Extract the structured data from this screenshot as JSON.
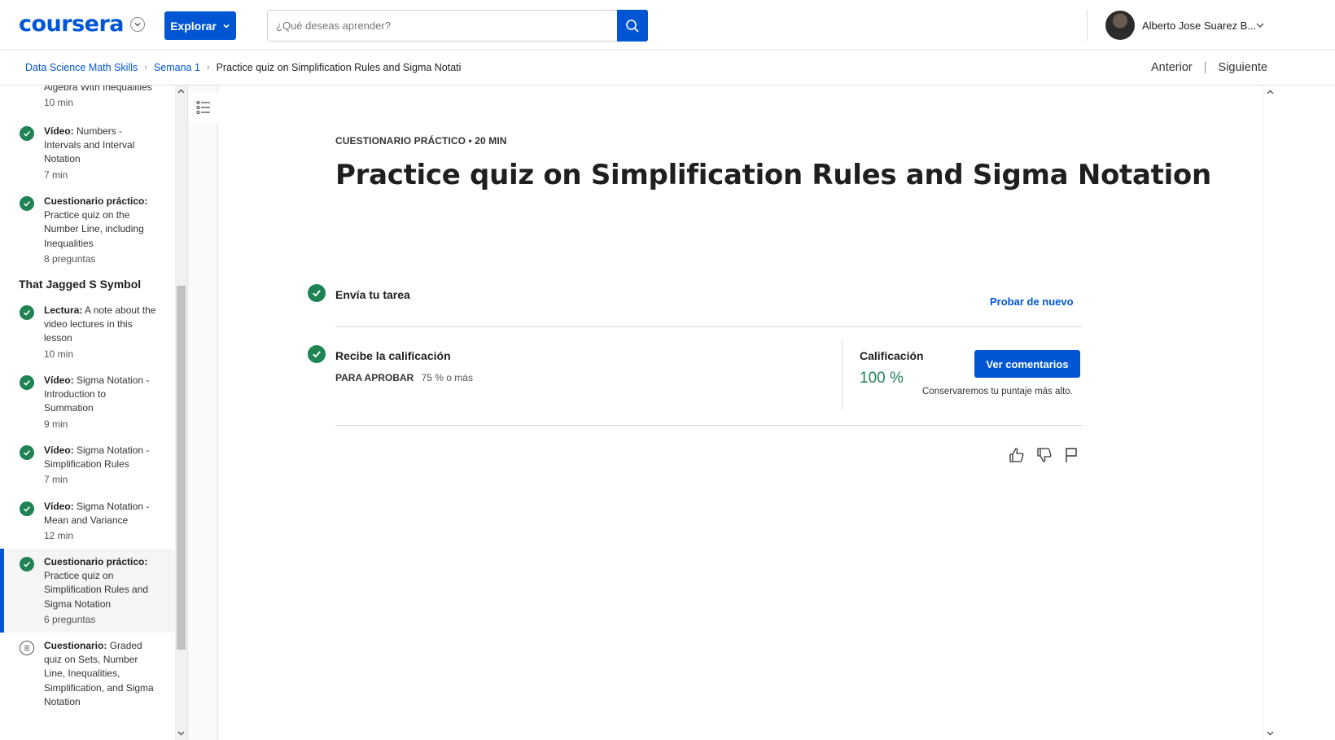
{
  "header": {
    "logo": "coursera",
    "explore_label": "Explorar",
    "search_placeholder": "¿Qué deseas aprender?",
    "user_name": "Alberto Jose Suarez B..."
  },
  "breadcrumb": {
    "course": "Data Science Math Skills",
    "week": "Semana 1",
    "current": "Practice quiz on Simplification Rules and Sigma Notati"
  },
  "nav": {
    "prev": "Anterior",
    "next": "Siguiente"
  },
  "sidebar": {
    "partial_item": {
      "text": "Algebra With Inequalities",
      "meta": "10 min"
    },
    "items_before": [
      {
        "type": "Vídeo:",
        "text": "Numbers - Intervals and Interval Notation",
        "meta": "7 min",
        "status": "complete"
      },
      {
        "type": "Cuestionario práctico:",
        "text": "Practice quiz on the Number Line, including Inequalities",
        "meta": "8 preguntas",
        "status": "complete"
      }
    ],
    "section_title": "That Jagged S Symbol",
    "items": [
      {
        "type": "Lectura:",
        "text": "A note about the video lectures in this lesson",
        "meta": "10 min",
        "status": "complete"
      },
      {
        "type": "Vídeo:",
        "text": "Sigma Notation - Introduction to Summation",
        "meta": "9 min",
        "status": "complete"
      },
      {
        "type": "Vídeo:",
        "text": "Sigma Notation - Simplification Rules",
        "meta": "7 min",
        "status": "complete"
      },
      {
        "type": "Vídeo:",
        "text": "Sigma Notation - Mean and Variance",
        "meta": "12 min",
        "status": "complete"
      },
      {
        "type": "Cuestionario práctico:",
        "text": "Practice quiz on Simplification Rules and Sigma Notation",
        "meta": "6 preguntas",
        "status": "complete",
        "active": true
      },
      {
        "type": "Cuestionario:",
        "text": "Graded quiz on Sets, Number Line, Inequalities, Simplification, and Sigma Notation",
        "meta": "",
        "status": "pending"
      }
    ]
  },
  "main": {
    "label": "CUESTIONARIO PRÁCTICO • 20 MIN",
    "title": "Practice quiz on Simplification Rules and Sigma Notation",
    "step1": {
      "title": "Envía tu tarea",
      "action": "Probar de nuevo"
    },
    "step2": {
      "title": "Recibe la calificación",
      "pass_label": "PARA APROBAR",
      "pass_value": "75 % o más",
      "grade_label": "Calificación",
      "grade_value": "100 %",
      "feedback_button": "Ver comentarios",
      "note": "Conservaremos tu puntaje más alto."
    }
  },
  "colors": {
    "brand": "#0056d2",
    "success": "#1f8354"
  }
}
